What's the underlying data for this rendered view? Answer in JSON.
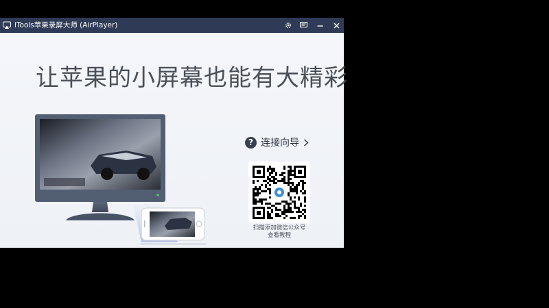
{
  "titlebar": {
    "title": "iTools苹果录屏大师 (AirPlayer)",
    "icons": [
      "airplay-icon",
      "gear-icon",
      "feedback-icon",
      "minimize-icon",
      "close-icon"
    ]
  },
  "main": {
    "headline": "让苹果的小屏幕也能有大精彩",
    "guide_label": "连接向导",
    "qr_caption_line1": "扫描添加微信公众号",
    "qr_caption_line2": "查看教程"
  },
  "colors": {
    "titlebar_bg": "#2e3a56",
    "content_bg": "#f2f4f8",
    "headline_text": "#4b4f57",
    "monitor_frame": "#4f5b6e"
  }
}
